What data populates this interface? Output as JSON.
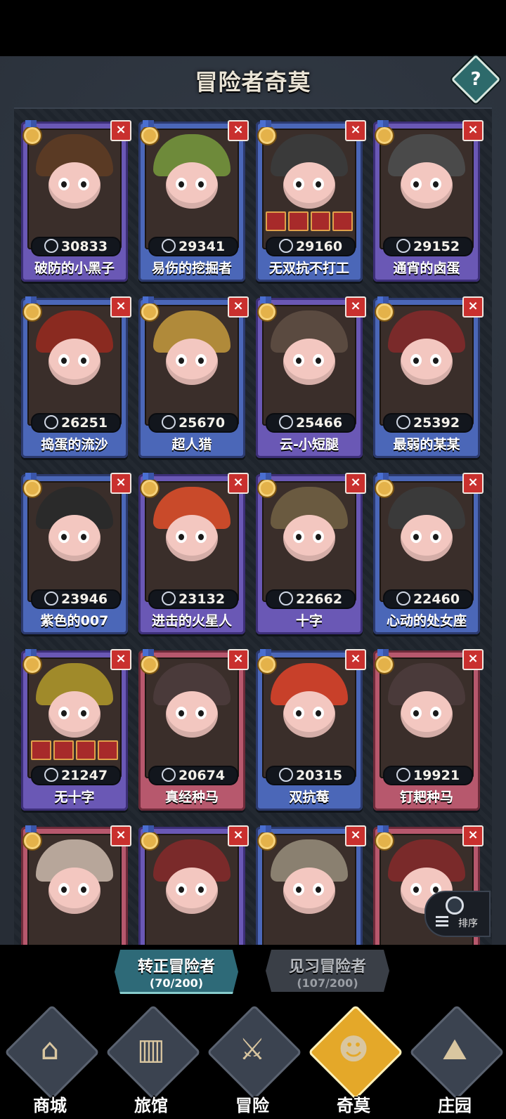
{
  "header": {
    "title": "冒险者奇莫",
    "help_label": "?"
  },
  "cards": [
    {
      "name": "破防的小黑子",
      "power": "30833",
      "stat_icon": "wrench-icon",
      "color": "purple"
    },
    {
      "name": "易伤的挖掘者",
      "power": "29341",
      "stat_icon": "brush-icon",
      "color": "blue"
    },
    {
      "name": "无双抗不打工",
      "power": "29160",
      "stat_icon": "target-icon",
      "color": "blue"
    },
    {
      "name": "通宵的卤蛋",
      "power": "29152",
      "stat_icon": "target-icon",
      "color": "purple"
    },
    {
      "name": "捣蛋的流沙",
      "power": "26251",
      "stat_icon": "wrench-icon",
      "color": "blue"
    },
    {
      "name": "超人猎",
      "power": "25670",
      "stat_icon": "target-icon",
      "color": "blue"
    },
    {
      "name": "云-小短腿",
      "power": "25466",
      "stat_icon": "wrench-icon",
      "color": "purple"
    },
    {
      "name": "最弱的某某",
      "power": "25392",
      "stat_icon": "wrench-icon",
      "color": "blue"
    },
    {
      "name": "紫色的007",
      "power": "23946",
      "stat_icon": "wrench-icon",
      "color": "blue"
    },
    {
      "name": "进击的火星人",
      "power": "23132",
      "stat_icon": "target-icon",
      "color": "purple"
    },
    {
      "name": "十字",
      "power": "22662",
      "stat_icon": "target-icon",
      "color": "purple"
    },
    {
      "name": "心动的处女座",
      "power": "22460",
      "stat_icon": "target-icon",
      "color": "blue"
    },
    {
      "name": "无十字",
      "power": "21247",
      "stat_icon": "wrench-icon",
      "color": "purple"
    },
    {
      "name": "真经种马",
      "power": "20674",
      "stat_icon": "wrench-icon",
      "color": "pink"
    },
    {
      "name": "双抗莓",
      "power": "20315",
      "stat_icon": "wrench-icon",
      "color": "blue"
    },
    {
      "name": "钉耙种马",
      "power": "19921",
      "stat_icon": "wrench-icon",
      "color": "pink"
    },
    {
      "name": "",
      "power": "",
      "stat_icon": "",
      "color": "pink"
    },
    {
      "name": "",
      "power": "",
      "stat_icon": "",
      "color": "purple"
    },
    {
      "name": "",
      "power": "",
      "stat_icon": "",
      "color": "blue"
    },
    {
      "name": "",
      "power": "",
      "stat_icon": "",
      "color": "pink"
    }
  ],
  "sort_button": {
    "label": "排序"
  },
  "tabs": [
    {
      "label": "转正冒险者",
      "count": "(70/200)",
      "active": true
    },
    {
      "label": "见习冒险者",
      "count": "(107/200)",
      "active": false
    }
  ],
  "nav": [
    {
      "label": "商城",
      "icon": "shop-icon",
      "glyph": "⌂",
      "sign": "SHOP"
    },
    {
      "label": "旅馆",
      "icon": "inn-door-icon",
      "glyph": "▥"
    },
    {
      "label": "冒险",
      "icon": "crossed-swords-icon",
      "glyph": "⚔"
    },
    {
      "label": "奇莫",
      "icon": "chicken-mascot-icon",
      "glyph": "☻",
      "active": true
    },
    {
      "label": "庄园",
      "icon": "manor-island-icon",
      "glyph": "⛰"
    }
  ],
  "colors": {
    "accent_gold": "#e4a829",
    "close_red": "#c9302e",
    "active_tab": "#2e6a78"
  }
}
